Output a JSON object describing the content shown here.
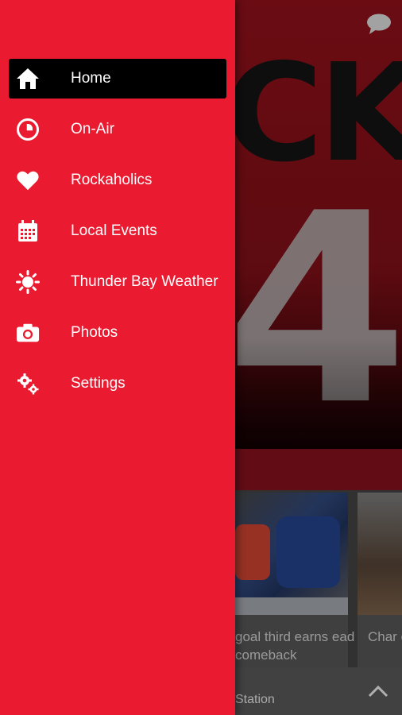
{
  "background": {
    "hero_word": "CK",
    "hero_number": "4",
    "cards": [
      {
        "title": "goal third earns ead comeback"
      },
      {
        "title": "Char comm"
      }
    ],
    "bottom_bar": {
      "text": "Station"
    },
    "colors": {
      "drawer": "#ea1b30",
      "hero": "#7e0f17"
    }
  },
  "drawer": {
    "items": [
      {
        "label": "Home",
        "icon": "home-icon",
        "active": true
      },
      {
        "label": "On-Air",
        "icon": "clock-icon",
        "active": false
      },
      {
        "label": "Rockaholics",
        "icon": "heart-icon",
        "active": false
      },
      {
        "label": "Local Events",
        "icon": "calendar-icon",
        "active": false
      },
      {
        "label": "Thunder Bay Weather",
        "icon": "sun-icon",
        "active": false
      },
      {
        "label": "Photos",
        "icon": "camera-icon",
        "active": false
      },
      {
        "label": "Settings",
        "icon": "gears-icon",
        "active": false
      }
    ]
  }
}
